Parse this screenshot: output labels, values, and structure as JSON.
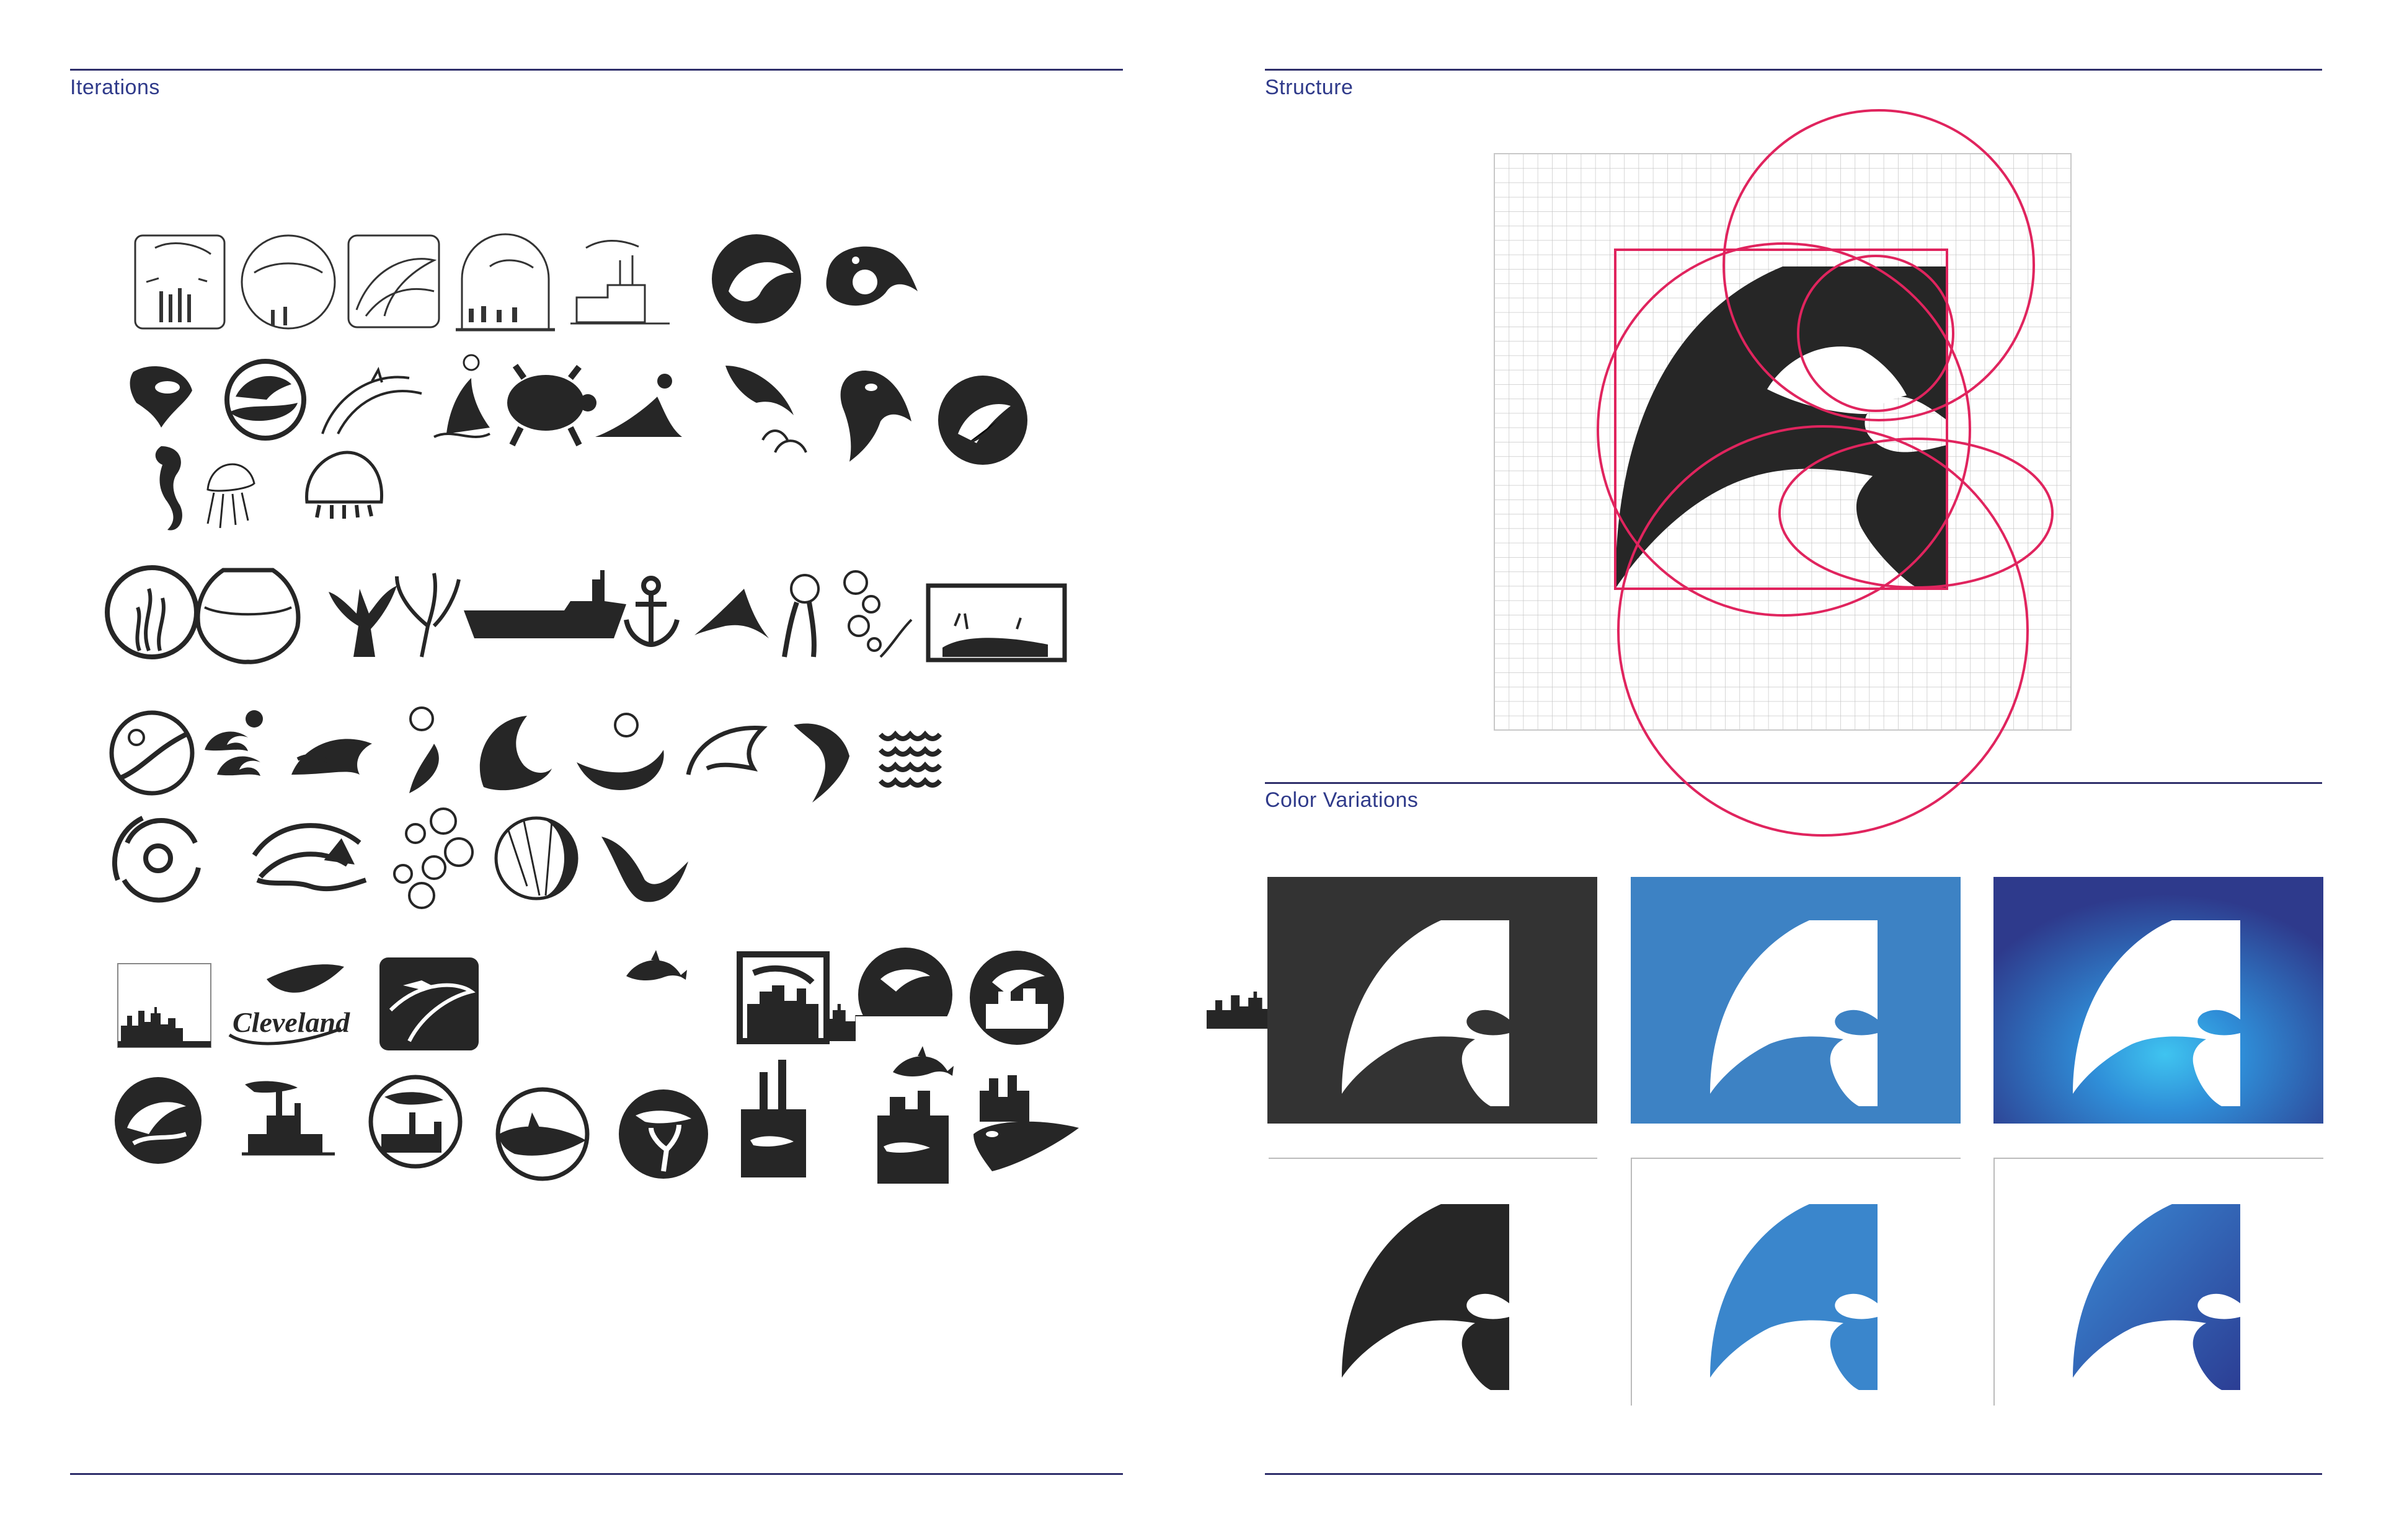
{
  "left_page": {
    "heading": "Iterations"
  },
  "right_page": {
    "structure_heading": "Structure",
    "color_heading": "Color Variations"
  },
  "colors": {
    "rule": "#2f2f6b",
    "heading_text": "#2f3a8a",
    "ink": "#262626",
    "guide": "#e0245e",
    "grid": "#c8c8c8",
    "dark_bg": "#333333",
    "blue_bg": "#3d82c4",
    "navy_bg": "#2e3a8c",
    "glow": "#3fc4f0",
    "mark_blue": "#3a86cc",
    "mark_navy": "#2c3e94"
  },
  "sketch_rows": [
    {
      "row": 1,
      "icons": [
        "aquarium-sketch-icon",
        "aquarium-circle-sketch-icon",
        "wave-sketch-icon",
        "dome-sketch-icon",
        "factory-sketch-icon",
        "whale-circle-icon",
        "orca-c-icon"
      ]
    },
    {
      "row": 2,
      "icons": [
        "fish-head-icon",
        "orca-wave-icon",
        "dolphin-pair-icon",
        "sea-lion-ball-icon",
        "turtle-icon",
        "seal-icon",
        "orca-jump-icon",
        "orca-c-icon",
        "orca-circle-icon"
      ]
    },
    {
      "row": 3,
      "icons": [
        "seahorse-icon",
        "jellyfish-icon",
        "jellyfish-dome-icon"
      ]
    },
    {
      "row": 4,
      "icons": [
        "kelp-circle-icon",
        "fishbowl-icon",
        "coral-icon",
        "coral-outline-icon",
        "ship-icon",
        "anchor-icon",
        "fin-icon",
        "ball-stick-icon",
        "bubbles-icon",
        "tank-icon"
      ]
    },
    {
      "row": 5,
      "icons": [
        "bubble-circle-icon",
        "splash-icon",
        "wave-icon",
        "ball-wave-icon",
        "wave-curl-icon",
        "ball-swirl-icon",
        "wave-outline-icon",
        "wave-hook-icon",
        "scales-icon"
      ]
    },
    {
      "row": 6,
      "icons": [
        "vortex-icon",
        "tail-wave-icon",
        "bubble-cluster-icon",
        "ball-moon-icon",
        "swoosh-icon"
      ]
    },
    {
      "row": 7,
      "icons": [
        "skyline-square-icon",
        "cleveland-orca-icon",
        "shark-wave-square-icon",
        "dolphin-skyline-icon",
        "skyline-frame-icon",
        "dolphin-skyline-circle-icon",
        "dolphin-skyline-circle-icon"
      ]
    },
    {
      "row": 8,
      "icons": [
        "dolphin-circle-icon",
        "shark-factory-icon",
        "shark-factory-circle-icon",
        "orca-circle-icon",
        "shark-coral-circle-icon",
        "factory-fish-icon",
        "dolphin-skyline-block-icon",
        "orca-skyline-icon"
      ]
    }
  ],
  "cleveland_text": "Cleveland"
}
